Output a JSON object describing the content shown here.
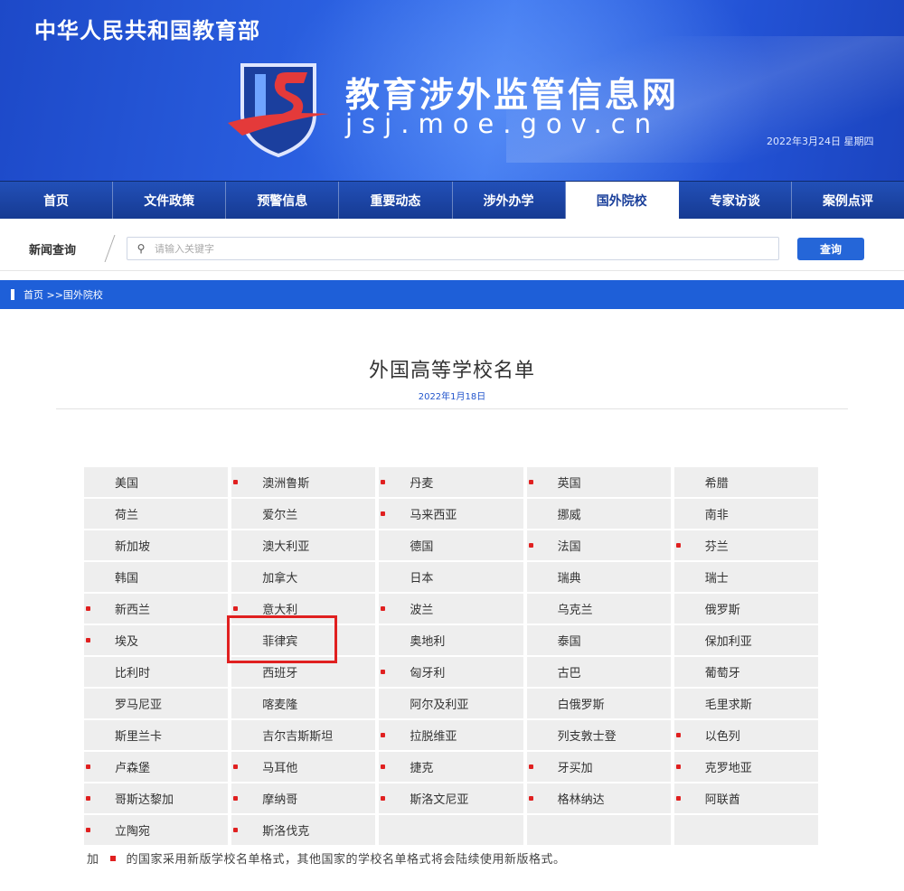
{
  "header": {
    "ministry": "中华人民共和国教育部",
    "site_title": "教育涉外监管信息网",
    "site_domain": "jsj.moe.gov.cn",
    "date": "2022年3月24日 星期四"
  },
  "nav": {
    "items": [
      {
        "label": "首页"
      },
      {
        "label": "文件政策"
      },
      {
        "label": "预警信息"
      },
      {
        "label": "重要动态"
      },
      {
        "label": "涉外办学"
      },
      {
        "label": "国外院校",
        "active": true
      },
      {
        "label": "专家访谈"
      },
      {
        "label": "案例点评"
      }
    ]
  },
  "search": {
    "label": "新闻查询",
    "placeholder": "请输入关键字",
    "button_label": "查询"
  },
  "breadcrumb": "首页 >>国外院校",
  "content": {
    "title": "外国高等学校名单",
    "date": "2022年1月18日",
    "countries": [
      {
        "name": "美国",
        "new_format": false
      },
      {
        "name": "澳洲鲁斯",
        "new_format": true
      },
      {
        "name": "丹麦",
        "new_format": true
      },
      {
        "name": "英国",
        "new_format": true
      },
      {
        "name": "希腊",
        "new_format": false
      },
      {
        "name": "荷兰",
        "new_format": false
      },
      {
        "name": "爱尔兰",
        "new_format": false
      },
      {
        "name": "马来西亚",
        "new_format": true
      },
      {
        "name": "挪威",
        "new_format": false
      },
      {
        "name": "南非",
        "new_format": false
      },
      {
        "name": "新加坡",
        "new_format": false
      },
      {
        "name": "澳大利亚",
        "new_format": false
      },
      {
        "name": "德国",
        "new_format": false
      },
      {
        "name": "法国",
        "new_format": true
      },
      {
        "name": "芬兰",
        "new_format": true
      },
      {
        "name": "韩国",
        "new_format": false
      },
      {
        "name": "加拿大",
        "new_format": false
      },
      {
        "name": "日本",
        "new_format": false
      },
      {
        "name": "瑞典",
        "new_format": false
      },
      {
        "name": "瑞士",
        "new_format": false
      },
      {
        "name": "新西兰",
        "new_format": true
      },
      {
        "name": "意大利",
        "new_format": true
      },
      {
        "name": "波兰",
        "new_format": true
      },
      {
        "name": "乌克兰",
        "new_format": false
      },
      {
        "name": "俄罗斯",
        "new_format": false
      },
      {
        "name": "埃及",
        "new_format": true
      },
      {
        "name": "菲律宾",
        "new_format": false
      },
      {
        "name": "奥地利",
        "new_format": false
      },
      {
        "name": "泰国",
        "new_format": false
      },
      {
        "name": "保加利亚",
        "new_format": false
      },
      {
        "name": "比利时",
        "new_format": false
      },
      {
        "name": "西班牙",
        "new_format": false
      },
      {
        "name": "匈牙利",
        "new_format": true
      },
      {
        "name": "古巴",
        "new_format": false
      },
      {
        "name": "葡萄牙",
        "new_format": false
      },
      {
        "name": "罗马尼亚",
        "new_format": false
      },
      {
        "name": "喀麦隆",
        "new_format": false
      },
      {
        "name": "阿尔及利亚",
        "new_format": false
      },
      {
        "name": "白俄罗斯",
        "new_format": false
      },
      {
        "name": "毛里求斯",
        "new_format": false
      },
      {
        "name": "斯里兰卡",
        "new_format": false
      },
      {
        "name": "吉尔吉斯斯坦",
        "new_format": false
      },
      {
        "name": "拉脱维亚",
        "new_format": true
      },
      {
        "name": "列支敦士登",
        "new_format": false
      },
      {
        "name": "以色列",
        "new_format": true
      },
      {
        "name": "卢森堡",
        "new_format": true
      },
      {
        "name": "马耳他",
        "new_format": true
      },
      {
        "name": "捷克",
        "new_format": true
      },
      {
        "name": "牙买加",
        "new_format": true
      },
      {
        "name": "克罗地亚",
        "new_format": true
      },
      {
        "name": "哥斯达黎加",
        "new_format": true
      },
      {
        "name": "摩纳哥",
        "new_format": true
      },
      {
        "name": "斯洛文尼亚",
        "new_format": true
      },
      {
        "name": "格林纳达",
        "new_format": true
      },
      {
        "name": "阿联酋",
        "new_format": true
      },
      {
        "name": "立陶宛",
        "new_format": true
      },
      {
        "name": "斯洛伐克",
        "new_format": true
      },
      {
        "name": "",
        "new_format": false
      },
      {
        "name": "",
        "new_format": false
      },
      {
        "name": "",
        "new_format": false
      }
    ],
    "footnote_prefix": "加",
    "footnote_text": "的国家采用新版学校名单格式，其他国家的学校名单格式将会陆续使用新版格式。"
  },
  "colors": {
    "banner": "#2353d6",
    "nav": "#1a3f9a",
    "accent": "#1e5fd8",
    "marker": "#e02020"
  }
}
